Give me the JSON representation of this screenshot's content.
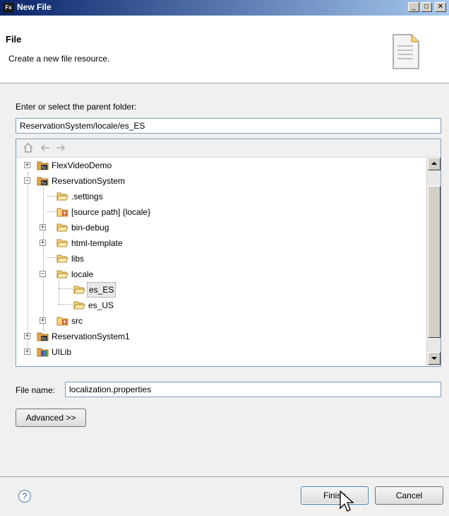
{
  "window": {
    "title": "New File",
    "icon_text": "Fx",
    "buttons": {
      "minimize": "_",
      "maximize": "□",
      "close": "✕"
    }
  },
  "banner": {
    "title": "File",
    "description": "Create a new file resource."
  },
  "parent_folder": {
    "label": "Enter or select the parent folder:",
    "value": "ReservationSystem/locale/es_ES"
  },
  "tree": {
    "toolbar": [
      "home-icon",
      "back-icon",
      "forward-icon"
    ],
    "items": [
      {
        "label": "FlexVideoDemo",
        "icon": "flex-project-icon",
        "expander": "+"
      },
      {
        "label": "ReservationSystem",
        "icon": "flex-project-icon",
        "expander": "−"
      },
      {
        "label": ".settings",
        "icon": "folder-icon"
      },
      {
        "label": "[source path] {locale}",
        "icon": "source-folder-icon"
      },
      {
        "label": "bin-debug",
        "icon": "folder-icon",
        "expander": "+"
      },
      {
        "label": "html-template",
        "icon": "folder-icon",
        "expander": "+"
      },
      {
        "label": "libs",
        "icon": "folder-icon"
      },
      {
        "label": "locale",
        "icon": "folder-icon",
        "expander": "−"
      },
      {
        "label": "es_ES",
        "icon": "folder-icon",
        "selected": true
      },
      {
        "label": "es_US",
        "icon": "folder-icon"
      },
      {
        "label": "src",
        "icon": "source-folder-icon",
        "expander": "+"
      },
      {
        "label": "ReservationSystem1",
        "icon": "flex-project-icon",
        "expander": "+"
      },
      {
        "label": "UILib",
        "icon": "library-project-icon",
        "expander": "+"
      }
    ]
  },
  "file_name": {
    "label": "File name:",
    "value": "localization.properties"
  },
  "advanced_button": "Advanced >>",
  "footer": {
    "help": "?",
    "finish": "Finish",
    "cancel": "Cancel"
  }
}
